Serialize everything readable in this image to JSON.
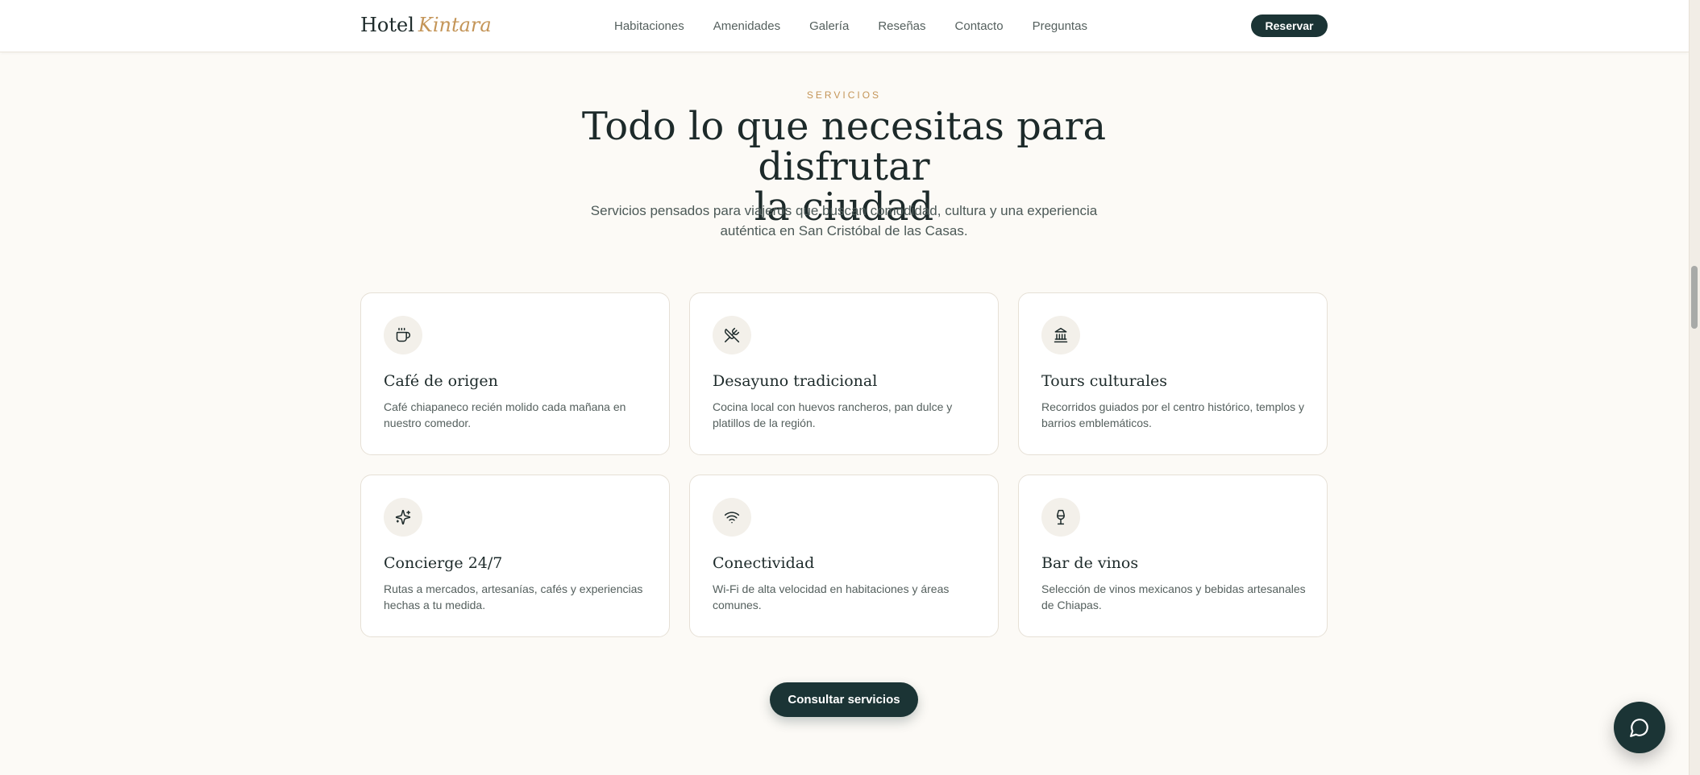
{
  "header": {
    "brand_name": "Hotel",
    "brand_accent": "Kintara",
    "nav": [
      {
        "label": "Habitaciones"
      },
      {
        "label": "Amenidades"
      },
      {
        "label": "Galería"
      },
      {
        "label": "Reseñas"
      },
      {
        "label": "Contacto"
      },
      {
        "label": "Preguntas"
      }
    ],
    "reserve_label": "Reservar"
  },
  "section": {
    "eyebrow": "SERVICIOS",
    "title_line1": "Todo lo que necesitas para disfrutar",
    "title_line2": "la ciudad",
    "subtitle_line1": "Servicios pensados para viajeros que buscan comodidad, cultura y una experiencia",
    "subtitle_line2": "auténtica en San Cristóbal de las Casas."
  },
  "cards": [
    {
      "icon": "coffee-cup-icon",
      "title": "Café de origen",
      "description": "Café chiapaneco recién molido cada mañana en nuestro comedor."
    },
    {
      "icon": "utensils-icon",
      "title": "Desayuno tradicional",
      "description": "Cocina local con huevos rancheros, pan dulce y platillos de la región."
    },
    {
      "icon": "landmark-icon",
      "title": "Tours culturales",
      "description": "Recorridos guiados por el centro histórico, templos y barrios emblemáticos."
    },
    {
      "icon": "sparkles-icon",
      "title": "Concierge 24/7",
      "description": "Rutas a mercados, artesanías, cafés y experiencias hechas a tu medida."
    },
    {
      "icon": "wifi-icon",
      "title": "Conectividad",
      "description": "Wi-Fi de alta velocidad en habitaciones y áreas comunes."
    },
    {
      "icon": "wine-glass-icon",
      "title": "Bar de vinos",
      "description": "Selección de vinos mexicanos y bebidas artesanales de Chiapas."
    }
  ],
  "cta_label": "Consultar servicios",
  "colors": {
    "primary": "#1b3435",
    "accent": "#c49558",
    "background": "#fcfaf6"
  }
}
